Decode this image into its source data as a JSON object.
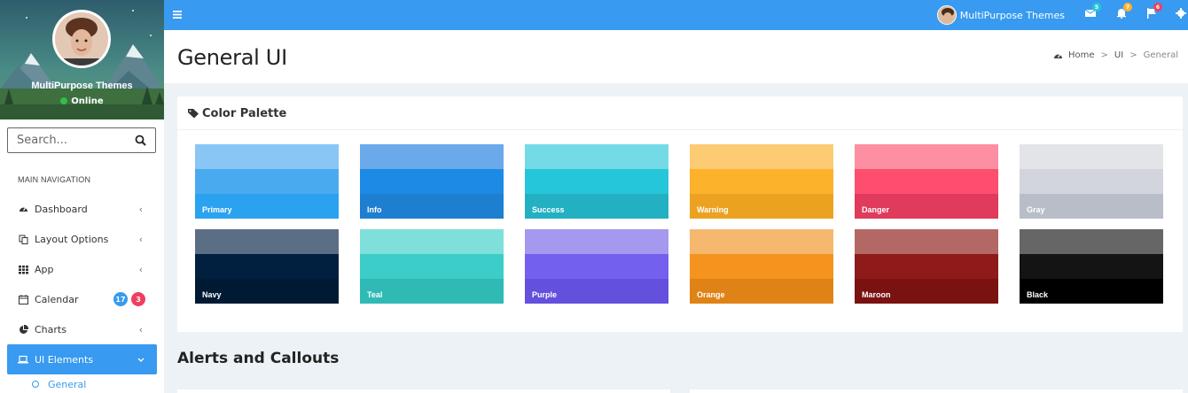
{
  "user": {
    "name": "MultiPurpose Themes",
    "status": "Online"
  },
  "search": {
    "placeholder": "Search..."
  },
  "sidebar": {
    "header": "MAIN NAVIGATION",
    "items": [
      {
        "label": "Dashboard",
        "icon": "dashboard-icon"
      },
      {
        "label": "Layout Options",
        "icon": "copy-icon"
      },
      {
        "label": "App",
        "icon": "grid-icon"
      },
      {
        "label": "Calendar",
        "icon": "calendar-icon",
        "badges": [
          {
            "text": "17",
            "color": "#389af0"
          },
          {
            "text": "3",
            "color": "#ef3f5f"
          }
        ]
      },
      {
        "label": "Charts",
        "icon": "pie-chart-icon"
      },
      {
        "label": "UI Elements",
        "icon": "laptop-icon",
        "active": true
      }
    ],
    "sub_items": [
      {
        "label": "General"
      }
    ]
  },
  "topbar": {
    "user_name": "MultiPurpose Themes",
    "badges": {
      "messages": "5",
      "notifications": "7",
      "flags": "6"
    },
    "badge_colors": {
      "messages": "#26c6da",
      "notifications": "#ffb22b",
      "flags": "#ef3f5f"
    }
  },
  "page": {
    "title": "General UI",
    "breadcrumb": [
      "Home",
      "UI",
      "General"
    ]
  },
  "palette": {
    "title": "Color Palette",
    "swatches": [
      {
        "label": "Primary",
        "colors": [
          "#89c6f6",
          "#4aaaf0",
          "#2aa2f0"
        ]
      },
      {
        "label": "Info",
        "colors": [
          "#6aaaeb",
          "#1d8ae6",
          "#1e7fd0"
        ]
      },
      {
        "label": "Success",
        "colors": [
          "#74dbe6",
          "#26c6da",
          "#22b0c2"
        ]
      },
      {
        "label": "Warning",
        "colors": [
          "#fdcb73",
          "#fdb22c",
          "#eca221"
        ]
      },
      {
        "label": "Danger",
        "colors": [
          "#fd8fa2",
          "#fd4e6f",
          "#e03a5c"
        ]
      },
      {
        "label": "Gray",
        "colors": [
          "#e2e4e8",
          "#d2d5dc",
          "#b8bdc8"
        ]
      },
      {
        "label": "Navy",
        "colors": [
          "#5c6d86",
          "#01203f",
          "#011a34"
        ]
      },
      {
        "label": "Teal",
        "colors": [
          "#7fdfdb",
          "#3ccdc8",
          "#2fbab6"
        ]
      },
      {
        "label": "Purple",
        "colors": [
          "#a498ef",
          "#7460ee",
          "#6350dc"
        ]
      },
      {
        "label": "Orange",
        "colors": [
          "#f6b86e",
          "#f5931f",
          "#df8317"
        ]
      },
      {
        "label": "Maroon",
        "colors": [
          "#b36866",
          "#8f1a1a",
          "#7b1212"
        ]
      },
      {
        "label": "Black",
        "colors": [
          "#666666",
          "#141414",
          "#000000"
        ]
      }
    ]
  },
  "alerts": {
    "title": "Alerts and Callouts"
  }
}
